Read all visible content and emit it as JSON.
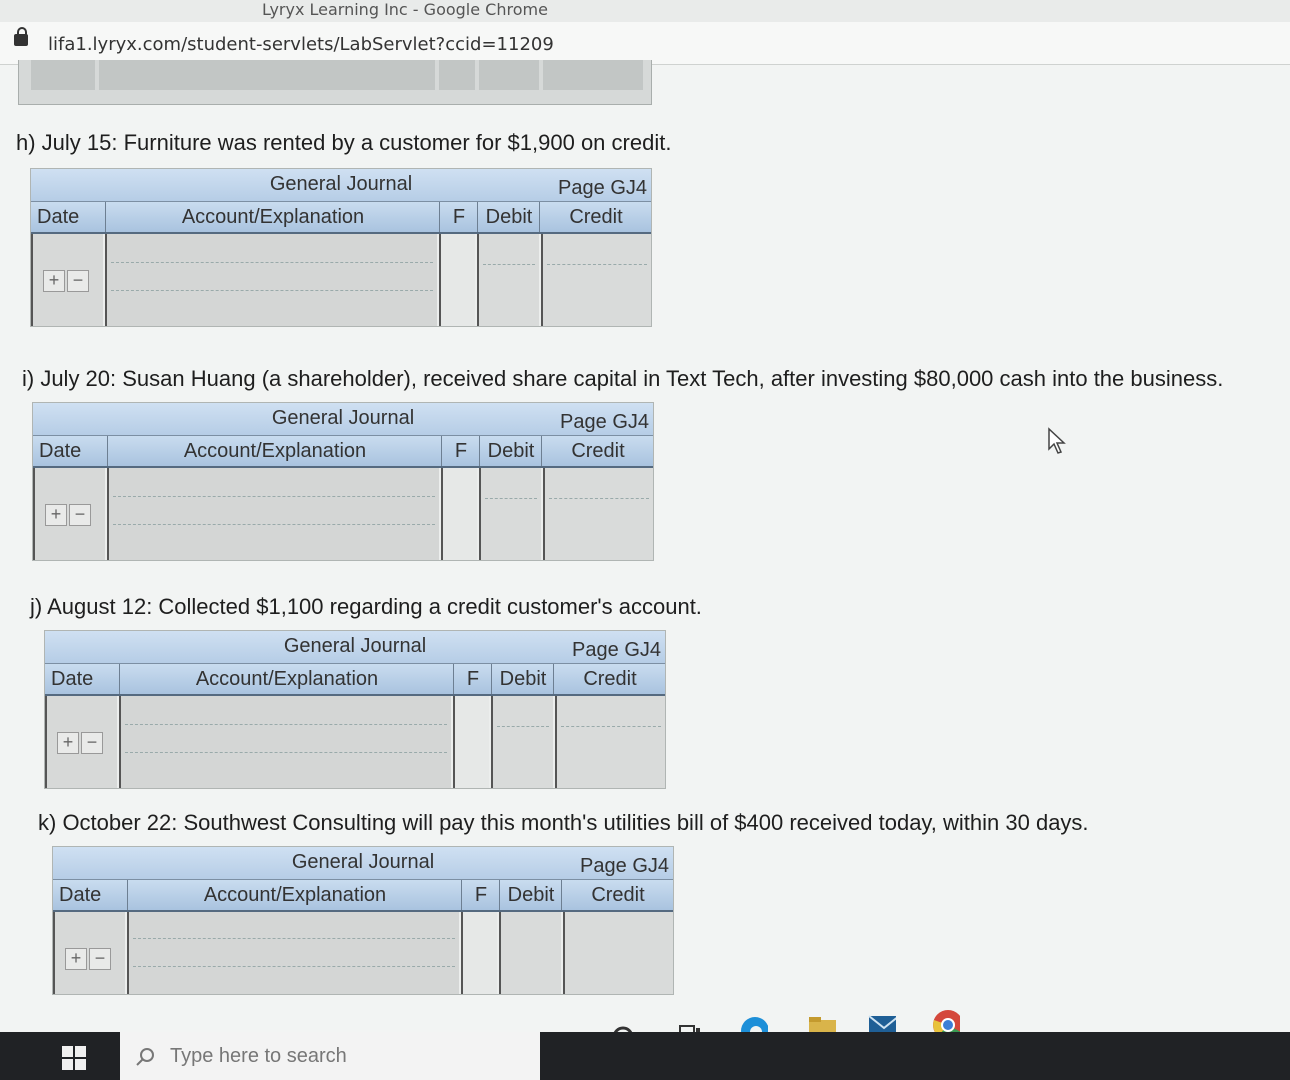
{
  "browser": {
    "title": "Lyryx Learning Inc - Google Chrome",
    "url": "lifa1.lyryx.com/student-servlets/LabServlet?ccid=11209"
  },
  "journal_labels": {
    "title": "General Journal",
    "page": "Page GJ4",
    "col_date": "Date",
    "col_account": "Account/Explanation",
    "col_f": "F",
    "col_debit": "Debit",
    "col_credit": "Credit",
    "add": "+",
    "remove": "−"
  },
  "questions": {
    "h": "h) July 15: Furniture was rented by a customer for $1,900 on credit.",
    "i": "i) July 20: Susan Huang (a shareholder), received share capital in Text Tech, after investing $80,000 cash into the business.",
    "j": "j) August 12: Collected $1,100 regarding a credit customer's account.",
    "k": "k) October 22: Southwest Consulting will pay this month's utilities bill of $400 received today, within 30 days."
  },
  "taskbar": {
    "search_placeholder": "Type here to search"
  }
}
